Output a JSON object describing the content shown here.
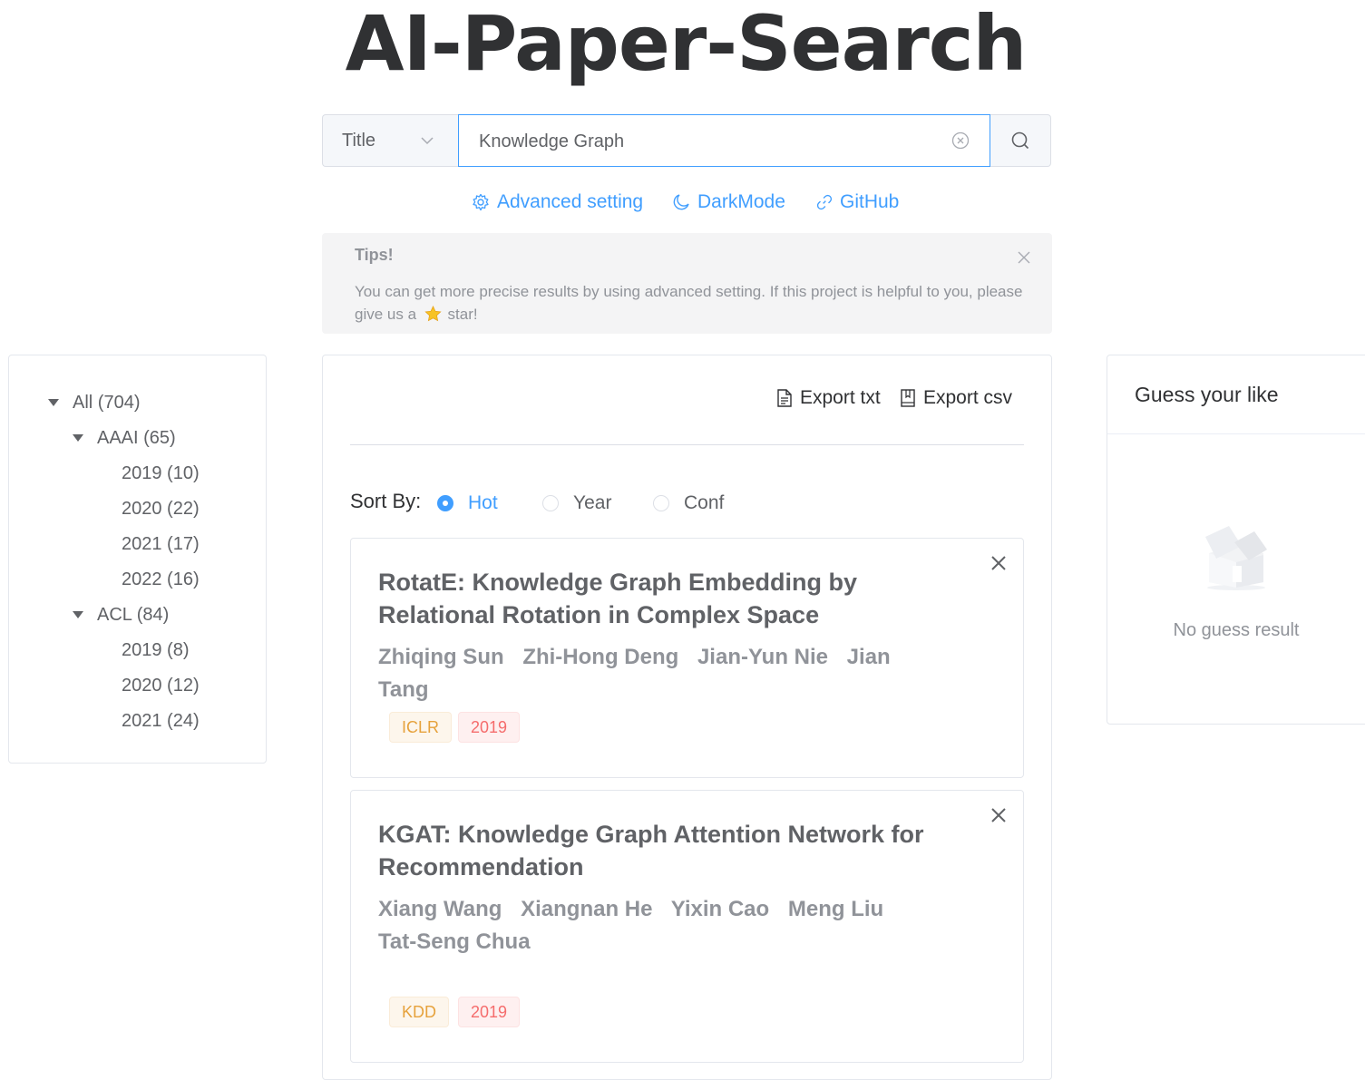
{
  "app": {
    "title": "AI-Paper-Search"
  },
  "search": {
    "field_selected": "Title",
    "query": "Knowledge Graph"
  },
  "links": {
    "advanced": "Advanced setting",
    "darkmode": "DarkMode",
    "github": "GitHub"
  },
  "tips": {
    "title": "Tips!",
    "text_before": "You can get more precise results by using advanced setting. If this project is helpful to you, please give us a",
    "star_icon": "star-emoji",
    "text_after": "star!"
  },
  "tree": {
    "all": "All (704)",
    "groups": [
      {
        "label": "AAAI (65)",
        "children": [
          "2019 (10)",
          "2020 (22)",
          "2021 (17)",
          "2022 (16)"
        ]
      },
      {
        "label": "ACL (84)",
        "children": [
          "2019 (8)",
          "2020 (12)",
          "2021 (24)"
        ]
      }
    ]
  },
  "results": {
    "export_txt": "Export txt",
    "export_csv": "Export csv",
    "sort_label": "Sort By:",
    "sort_options": [
      "Hot",
      "Year",
      "Conf"
    ],
    "sort_selected": "Hot",
    "papers": [
      {
        "title": "RotatE: Knowledge Graph Embedding by Relational Rotation in Complex Space",
        "authors": [
          "Zhiqing Sun",
          "Zhi-Hong Deng",
          "Jian-Yun Nie",
          "Jian Tang"
        ],
        "conf": "ICLR",
        "year": "2019"
      },
      {
        "title": "KGAT: Knowledge Graph Attention Network for Recommendation",
        "authors": [
          "Xiang Wang",
          "Xiangnan He",
          "Yixin Cao",
          "Meng Liu",
          "Tat-Seng Chua"
        ],
        "conf": "KDD",
        "year": "2019"
      }
    ]
  },
  "guess": {
    "title": "Guess your like",
    "empty_text": "No guess result"
  },
  "colors": {
    "accent": "#409eff",
    "tag_conf": "#e6a23c",
    "tag_year": "#f56c6c"
  }
}
